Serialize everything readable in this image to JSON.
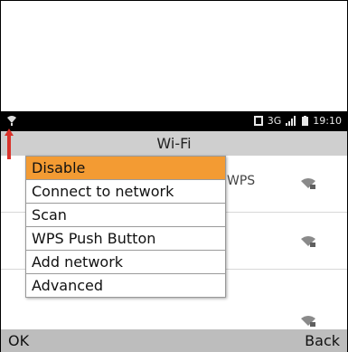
{
  "statusbar": {
    "network": "3G",
    "time": "19:10"
  },
  "header": {
    "title": "Wi-Fi"
  },
  "list": {
    "rows": [
      {
        "label": "WPS"
      },
      {
        "label": ""
      },
      {
        "label": ""
      }
    ]
  },
  "menu": {
    "items": [
      {
        "label": "Disable",
        "selected": true
      },
      {
        "label": "Connect to network"
      },
      {
        "label": "Scan"
      },
      {
        "label": "WPS Push Button"
      },
      {
        "label": "Add network"
      },
      {
        "label": "Advanced"
      }
    ]
  },
  "softkeys": {
    "left": "OK",
    "right": "Back"
  },
  "colors": {
    "accent": "#f39b33",
    "arrow": "#d9322a"
  }
}
